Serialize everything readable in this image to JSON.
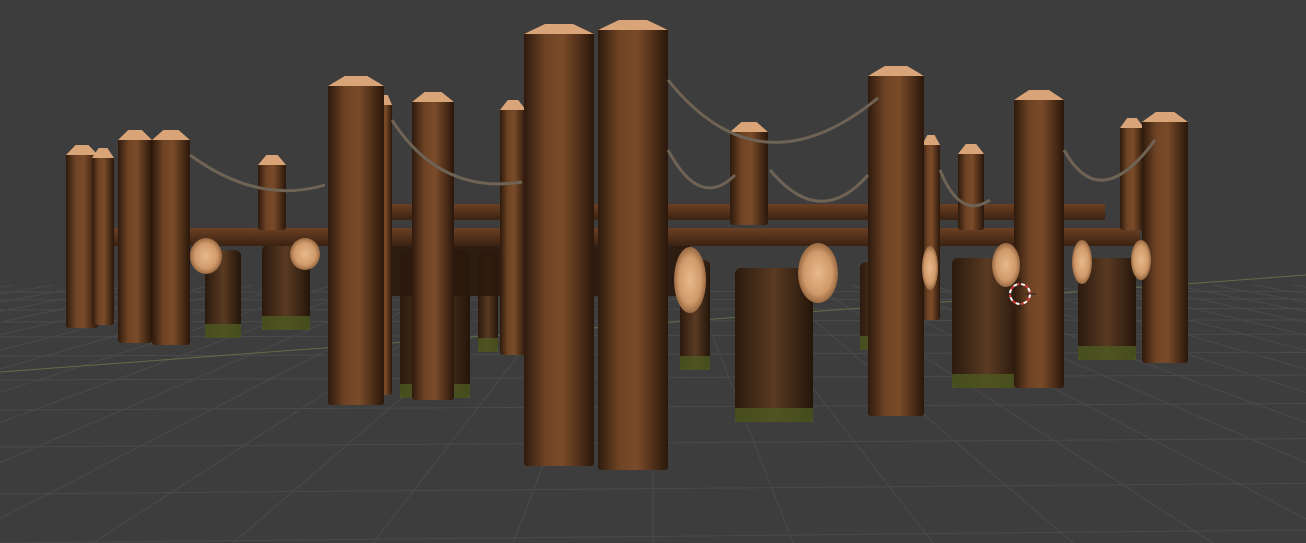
{
  "viewport": {
    "background_color": "#3d3d3d",
    "grid_color": "#4a4a4a",
    "x_axis_color": "#6b7d4a",
    "wood_color": "#6a3f22",
    "wood_dark": "#3a2212",
    "cut_end_color": "#d9a478",
    "rope_color": "#6e6354",
    "moss_color": "#4d5a22",
    "cursor_color": "#d43c3c"
  }
}
